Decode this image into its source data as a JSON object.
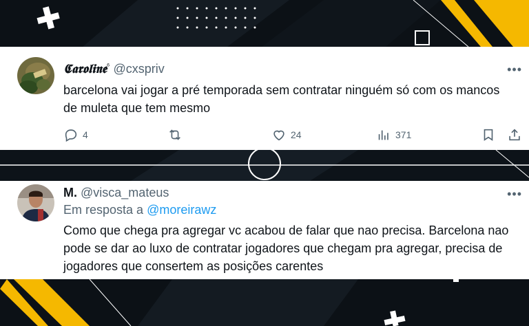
{
  "tweet1": {
    "display_name": "𝕮𝖆𝖗𝖔𝖑𝖎𝖓𝖊",
    "name_suffix": "⁶",
    "handle": "@cxspriv",
    "text": "barcelona vai jogar a pré temporada sem contratar ninguém só com os mancos de muleta que tem mesmo",
    "replies": "4",
    "retweets": "",
    "likes": "24",
    "views": "371"
  },
  "tweet2": {
    "display_name": "M.",
    "handle": "@visca_mateus",
    "reply_prefix": "Em resposta a",
    "reply_to": "@moreirawz",
    "text": "Como que chega pra agregar vc acabou de falar que nao precisa. Barcelona nao pode se dar ao luxo de contratar jogadores que chegam pra agregar, precisa de jogadores que consertem as posições carentes"
  },
  "colors": {
    "background": "#0c1116",
    "accent_yellow": "#f5b800",
    "link_blue": "#1d9bf0",
    "text_dark": "#0f1419",
    "text_gray": "#536471"
  }
}
